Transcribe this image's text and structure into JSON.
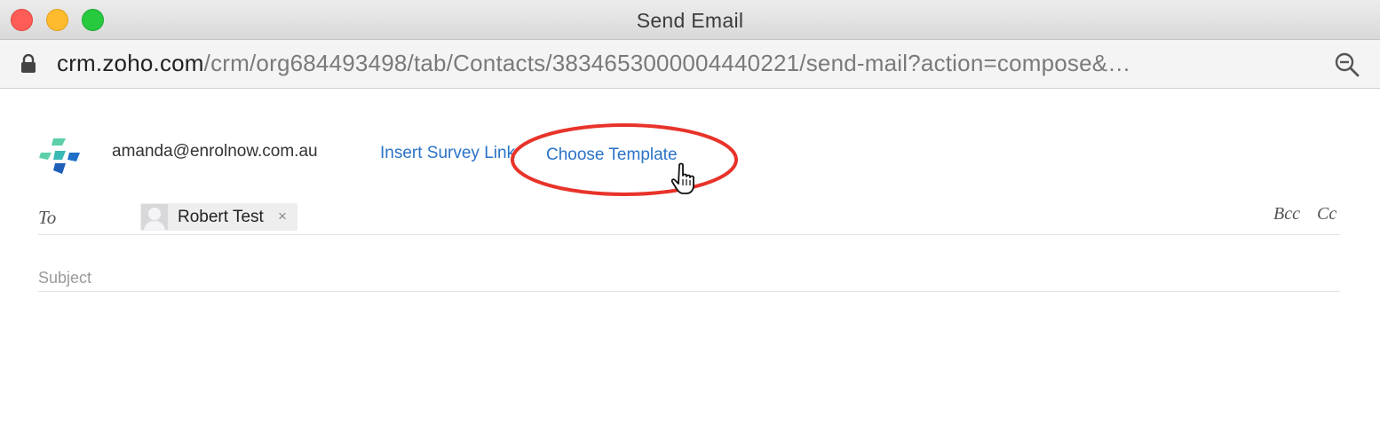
{
  "window": {
    "title": "Send Email",
    "controls": [
      "close",
      "minimize",
      "maximize"
    ]
  },
  "address_bar": {
    "host": "crm.zoho.com",
    "path": "/crm/org684493498/tab/Contacts/3834653000004440221/send-mail?action=compose&…",
    "icons": [
      "lock-icon",
      "zoom-icon"
    ]
  },
  "compose": {
    "logo": "zoho-crm-logo-icon",
    "from_email": "amanda@enrolnow.com.au",
    "insert_survey_label": "Insert Survey Link",
    "choose_template_label": "Choose Template",
    "to_label": "To",
    "recipients": [
      {
        "name": "Robert Test",
        "remove": "×"
      }
    ],
    "bcc_label": "Bcc",
    "cc_label": "Cc",
    "subject_placeholder": "Subject",
    "subject_value": ""
  },
  "annotation": {
    "type": "ellipse",
    "color": "#e8332a",
    "target": "Choose Template"
  },
  "colors": {
    "link": "#2a73c7",
    "annotation": "#e8332a"
  }
}
